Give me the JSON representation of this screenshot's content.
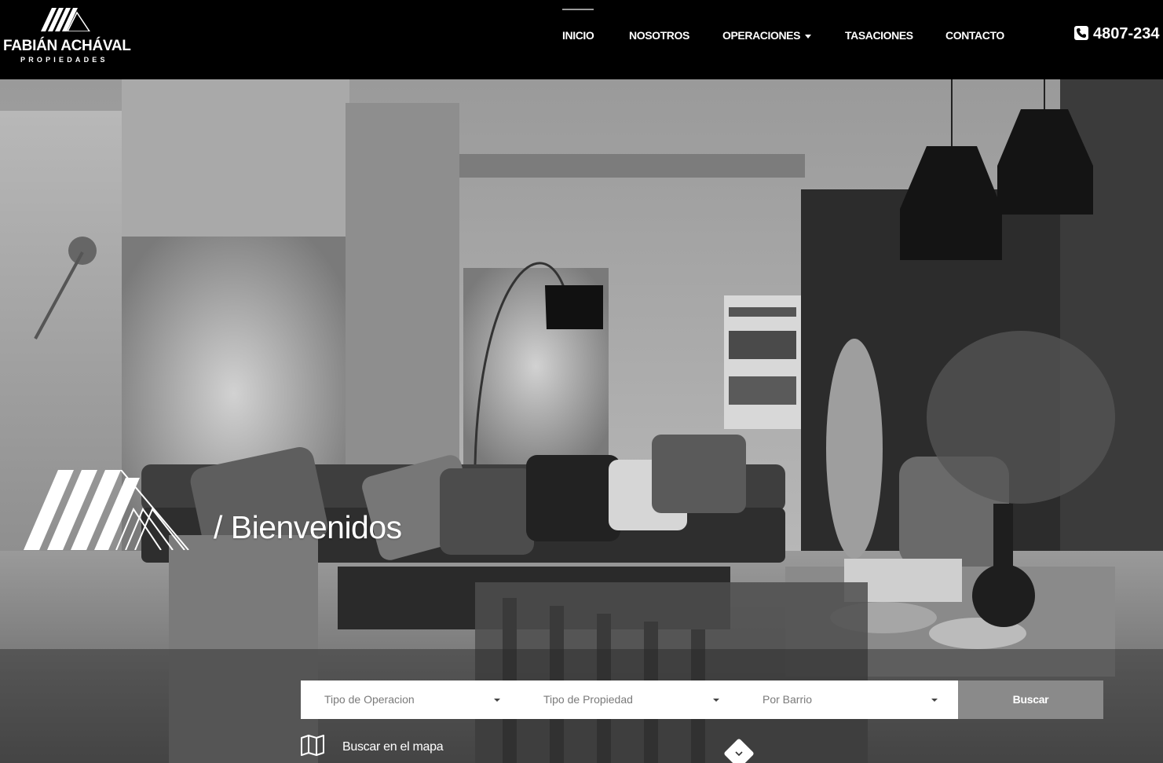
{
  "brand": {
    "name": "FABIÁN ACHÁVAL",
    "subtitle": "PROPIEDADES"
  },
  "nav": {
    "items": [
      {
        "label": "INICIO",
        "active": true
      },
      {
        "label": "NOSOTROS"
      },
      {
        "label": "OPERACIONES",
        "dropdown": true
      },
      {
        "label": "TASACIONES"
      },
      {
        "label": "CONTACTO"
      }
    ]
  },
  "phone": {
    "number": "4807-234",
    "icon": "phone-icon"
  },
  "hero": {
    "welcome": "/ Bienvenidos",
    "image_style": "grayscale"
  },
  "search": {
    "operation_placeholder": "Tipo de Operacion",
    "property_placeholder": "Tipo de Propiedad",
    "neighborhood_placeholder": "Por Barrio",
    "button_label": "Buscar",
    "map_link": "Buscar en el mapa"
  }
}
